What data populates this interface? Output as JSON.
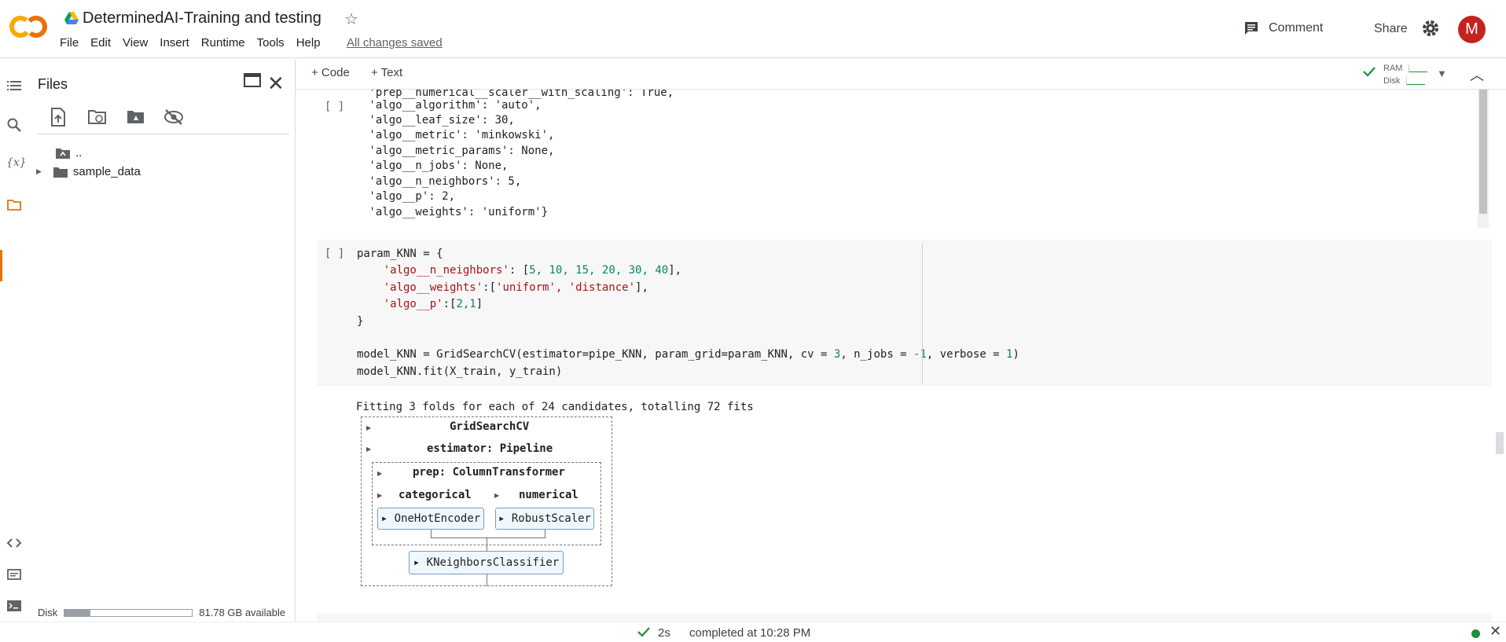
{
  "header": {
    "title": "DeterminedAI-Training and testing",
    "menu": [
      "File",
      "Edit",
      "View",
      "Insert",
      "Runtime",
      "Tools",
      "Help"
    ],
    "saved_status": "All changes saved",
    "comment_label": "Comment",
    "share_label": "Share",
    "avatar_initial": "M",
    "logo_text": "CO"
  },
  "files": {
    "title": "Files",
    "tree": [
      {
        "label": "..",
        "icon": "folder-up-icon"
      },
      {
        "label": "sample_data",
        "icon": "folder-icon"
      }
    ],
    "disk_label": "Disk",
    "disk_available": "81.78 GB available",
    "disk_used_fraction": 0.2
  },
  "toolbar": {
    "add_code": "+ Code",
    "add_text": "+ Text",
    "ram_label": "RAM",
    "disk_label": "Disk"
  },
  "output1": {
    "bracket": "[ ]",
    "lines": [
      " 'prep__numerical__scaler__with_scaling': True,",
      " 'algo__algorithm': 'auto',",
      " 'algo__leaf_size': 30,",
      " 'algo__metric': 'minkowski',",
      " 'algo__metric_params': None,",
      " 'algo__n_jobs': None,",
      " 'algo__n_neighbors': 5,",
      " 'algo__p': 2,",
      " 'algo__weights': 'uniform'}"
    ]
  },
  "cell2": {
    "bracket": "[ ]",
    "line1": "param_KNN = {",
    "line2_key": "'algo__n_neighbors'",
    "line2_rest_a": ": [",
    "line2_nums": "5, 10, 15, 20, 30, 40",
    "line2_rest_b": "],",
    "line3_key": "'algo__weights'",
    "line3_mid": ":[",
    "line3_vals": "'uniform', 'distance'",
    "line3_end": "],",
    "line4_key": "'algo__p'",
    "line4_mid": ":[",
    "line4_nums": "2,1",
    "line4_end": "]",
    "line5": "}",
    "line6_a": "model_KNN = GridSearchCV(estimator=pipe_KNN, param_grid=param_KNN, cv = ",
    "line6_cv": "3",
    "line6_b": ", n_jobs = ",
    "line6_jobs": "-1",
    "line6_c": ", verbose = ",
    "line6_verbose": "1",
    "line6_d": ")",
    "line7": "model_KNN.fit(X_train, y_train)"
  },
  "output2": {
    "fit_text": "Fitting 3 folds for each of 24 candidates, totalling 72 fits",
    "gridsearch": "GridSearchCV",
    "estimator": "estimator: Pipeline",
    "prep": "prep: ColumnTransformer",
    "categorical": "categorical",
    "numerical": "numerical",
    "onehot": "OneHotEncoder",
    "robust": "RobustScaler",
    "knn": "KNeighborsClassifier"
  },
  "status": {
    "duration": "2s",
    "completed": "completed at 10:28 PM",
    "connected_color": "#1e8e3e"
  }
}
